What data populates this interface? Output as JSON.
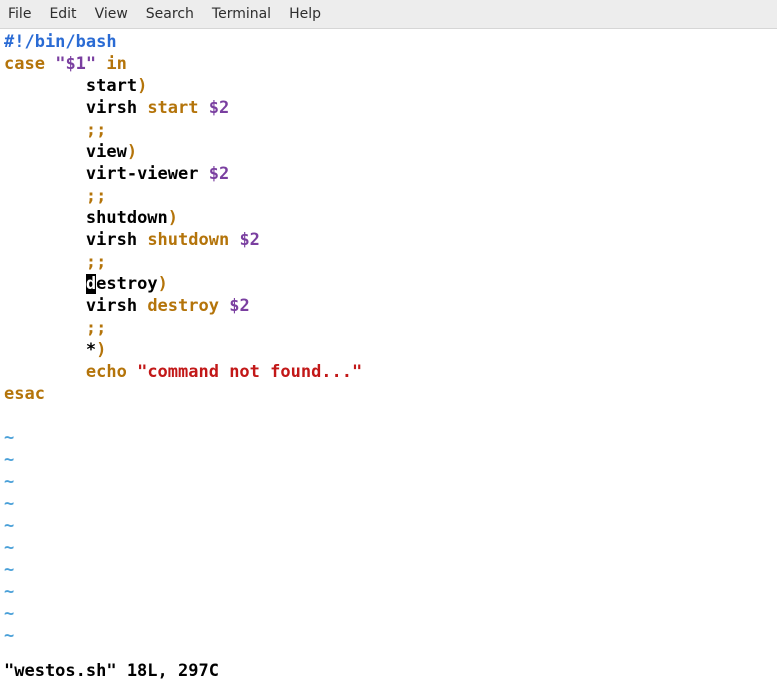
{
  "menubar": {
    "file": "File",
    "edit": "Edit",
    "view": "View",
    "search": "Search",
    "terminal": "Terminal",
    "help": "Help"
  },
  "code": {
    "shebang": "#!/bin/bash",
    "case_kw": "case",
    "arg1": "\"$1\"",
    "in_kw": "in",
    "indent": "        ",
    "start_label": "start",
    "paren": ")",
    "virsh": "virsh ",
    "start_cmd": "start",
    "arg2": " $2",
    "dsemi": ";;",
    "view_label": "view",
    "virtviewer": "virt-viewer",
    "shutdown_label": "shutdown",
    "shutdown_cmd": "shutdown",
    "destroy_d": "d",
    "destroy_rest": "estroy",
    "destroy_cmd": "destroy",
    "star": "*",
    "echo": "echo ",
    "notfound": "\"command not found...\"",
    "esac": "esac",
    "tilde": "~"
  },
  "status": "\"westos.sh\" 18L, 297C"
}
